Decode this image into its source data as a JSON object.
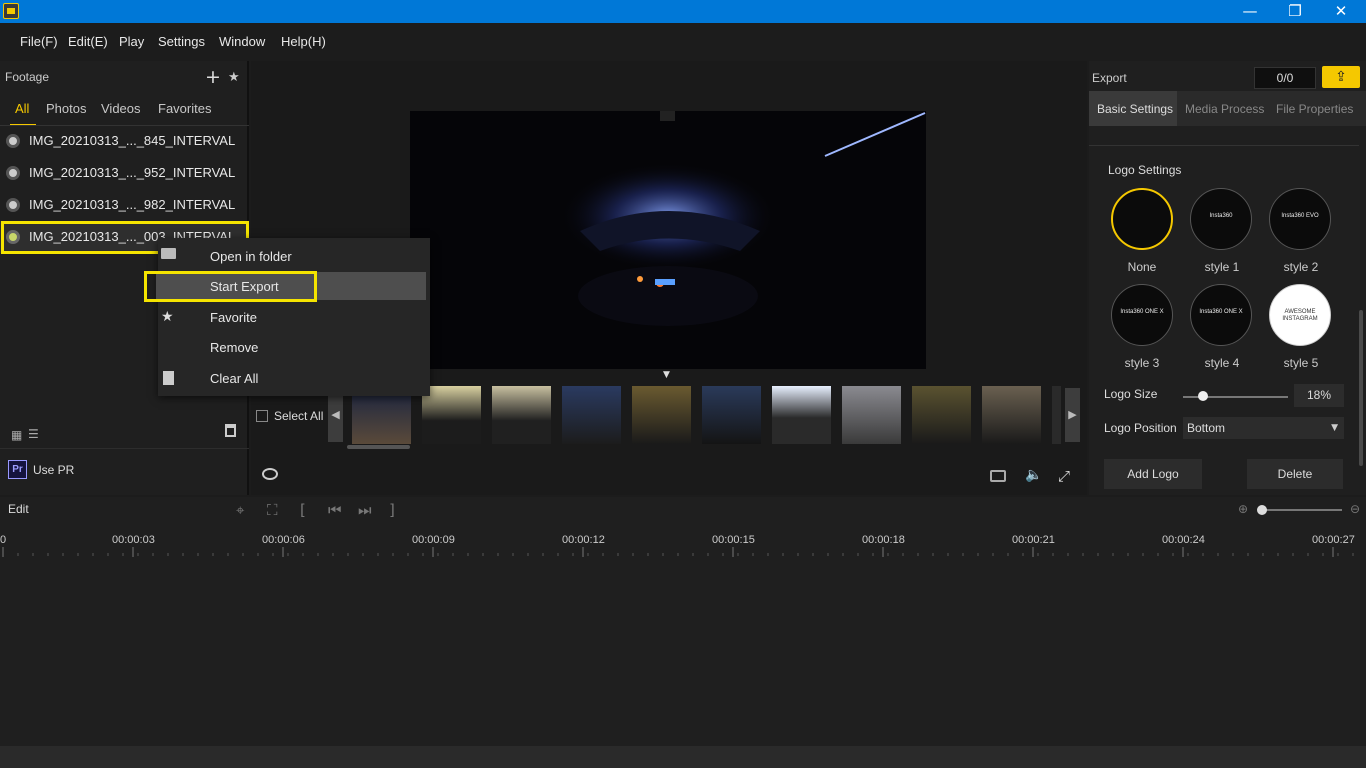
{
  "menu": {
    "items": [
      "File(F)",
      "Edit(E)",
      "Play",
      "Settings",
      "Window",
      "Help(H)"
    ]
  },
  "window": {
    "minimize": "—",
    "restore": "❐",
    "close": "✕"
  },
  "footage": {
    "title": "Footage",
    "tabs": [
      "All",
      "Photos",
      "Videos",
      "Favorites"
    ],
    "files": [
      "IMG_20210313_..._845_INTERVAL",
      "IMG_20210313_..._952_INTERVAL",
      "IMG_20210313_..._982_INTERVAL",
      "IMG_20210313_..._003_INTERVAL"
    ],
    "use_pr": "Use PR",
    "pr_badge": "Pr"
  },
  "context_menu": {
    "items": [
      "Open in folder",
      "Start Export",
      "Favorite",
      "Remove",
      "Clear All"
    ]
  },
  "preview": {
    "select_all": "Select All"
  },
  "export": {
    "title": "Export",
    "count": "0/0",
    "tabs": [
      "Basic Settings",
      "Media Process",
      "File Properties"
    ],
    "logo_settings": "Logo Settings",
    "logos": [
      {
        "label": "None",
        "text": ""
      },
      {
        "label": "style 1",
        "text": "Insta360"
      },
      {
        "label": "style 2",
        "text": "Insta360 EVO"
      },
      {
        "label": "style 3",
        "text": "Insta360 ONE X"
      },
      {
        "label": "style 4",
        "text": "Insta360 ONE X"
      },
      {
        "label": "style 5",
        "text": "AWESOME INSTAGRAM"
      }
    ],
    "logo_size_label": "Logo Size",
    "logo_size_value": "18%",
    "logo_size_fraction": 0.18,
    "logo_position_label": "Logo Position",
    "logo_position_value": "Bottom",
    "add_logo": "Add Logo",
    "delete": "Delete"
  },
  "timeline": {
    "edit_label": "Edit",
    "ticks": [
      "0",
      "00:00:03",
      "00:00:06",
      "00:00:09",
      "00:00:12",
      "00:00:15",
      "00:00:18",
      "00:00:21",
      "00:00:24",
      "00:00:27"
    ]
  },
  "colors": {
    "accent": "#f5c800",
    "titlebar": "#0078d7",
    "highlight": "#f5e400"
  }
}
